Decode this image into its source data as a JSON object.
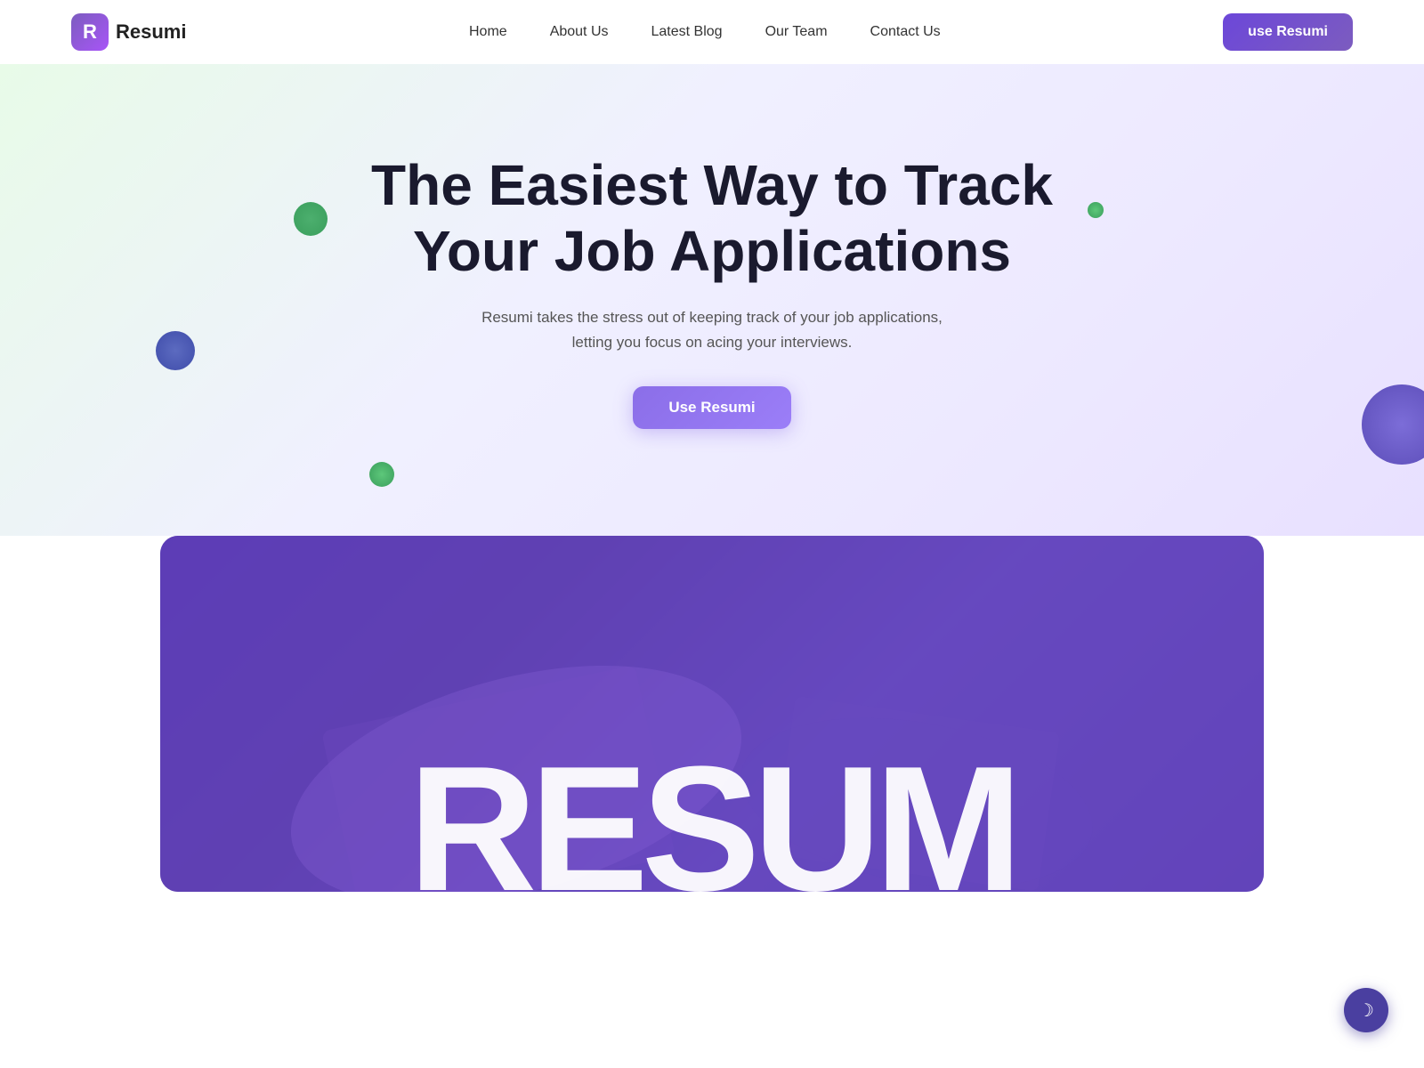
{
  "brand": {
    "logo_letter": "R",
    "name": "Resumi"
  },
  "nav": {
    "links": [
      {
        "label": "Home",
        "id": "home"
      },
      {
        "label": "About Us",
        "id": "about"
      },
      {
        "label": "Latest Blog",
        "id": "blog"
      },
      {
        "label": "Our Team",
        "id": "team"
      },
      {
        "label": "Contact Us",
        "id": "contact"
      }
    ],
    "cta_label": "use Resumi"
  },
  "hero": {
    "title": "The Easiest Way to Track Your Job Applications",
    "subtitle": "Resumi takes the stress out of keeping track of your job applications, letting you focus on acing your interviews.",
    "cta_label": "Use Resumi"
  },
  "preview": {
    "text": "RESUM"
  },
  "dark_mode_icon": "☽"
}
